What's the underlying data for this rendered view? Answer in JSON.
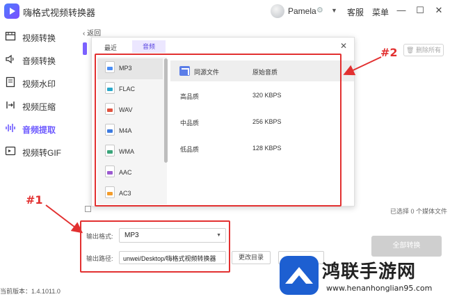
{
  "app": {
    "title": "嗨格式视频转换器",
    "user_name": "Pamela",
    "service_label": "客服",
    "menu_label": "菜单",
    "minimize_glyph": "—",
    "maximize_glyph": "☐",
    "close_glyph": "✕"
  },
  "sidebar": {
    "items": [
      {
        "label": "视频转换",
        "icon": "video-convert-icon"
      },
      {
        "label": "音频转换",
        "icon": "speaker-icon"
      },
      {
        "label": "视频水印",
        "icon": "watermark-icon"
      },
      {
        "label": "视频压缩",
        "icon": "compress-icon"
      },
      {
        "label": "音频提取",
        "icon": "waveform-icon",
        "active": true
      },
      {
        "label": "视频转GIF",
        "icon": "gif-icon"
      }
    ]
  },
  "main": {
    "back_label": "返回",
    "clear_label": "删除所有",
    "selected_text": "已选择 0 个媒体文件",
    "output_format_label": "输出格式:",
    "output_format_value": "MP3",
    "output_path_label": "输出路径:",
    "output_path_value": "unwei/Desktop/嗨格式视频转换器",
    "change_dir_label": "更改目录",
    "convert_all_label": "全部转换",
    "version_text": "当前版本：1.4.1011.0"
  },
  "dialog": {
    "tabs": [
      {
        "label": "最近",
        "active": false
      },
      {
        "label": "音频",
        "active": true
      }
    ],
    "close_glyph": "✕",
    "formats": [
      {
        "name": "MP3",
        "color": "#4b8ef5",
        "selected": true
      },
      {
        "name": "FLAC",
        "color": "#2aa8c9"
      },
      {
        "name": "WAV",
        "color": "#e0533f"
      },
      {
        "name": "M4A",
        "color": "#3d7be0"
      },
      {
        "name": "WMA",
        "color": "#3aa57a"
      },
      {
        "name": "AAC",
        "color": "#9b59d0"
      },
      {
        "name": "AC3",
        "color": "#f39c2b"
      }
    ],
    "qualities": [
      {
        "name": "同源文件",
        "rate": "原始音质",
        "selected": true
      },
      {
        "name": "高品质",
        "rate": "320 KBPS"
      },
      {
        "name": "中品质",
        "rate": "256 KBPS"
      },
      {
        "name": "低品质",
        "rate": "128 KBPS"
      }
    ]
  },
  "annotations": {
    "label_1": "#1",
    "label_2": "#2",
    "color": "#e23030"
  },
  "watermark": {
    "title": "鸿联手游网",
    "url": "www.henanhonglian95.com"
  }
}
